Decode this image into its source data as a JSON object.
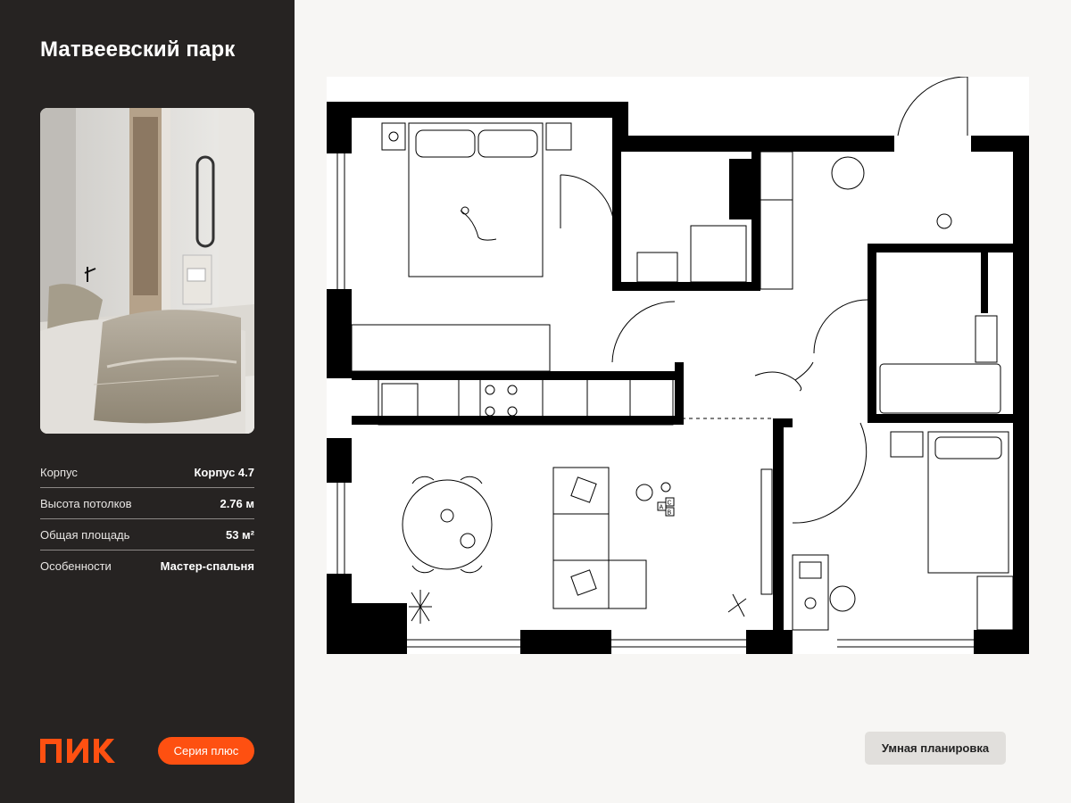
{
  "project": {
    "title": "Матвеевский парк"
  },
  "specs": [
    {
      "label": "Корпус",
      "value": "Корпус 4.7"
    },
    {
      "label": "Высота потолков",
      "value": "2.76 м"
    },
    {
      "label": "Общая площадь",
      "value": "53 м²"
    },
    {
      "label": "Особенности",
      "value": "Мастер-спальня"
    }
  ],
  "brand": {
    "logo_text": "ПИК",
    "accent_color": "#fe5011"
  },
  "series_button": {
    "label": "Серия плюс"
  },
  "badge": {
    "label": "Умная планировка"
  },
  "floorplan": {
    "toy_blocks": [
      "A",
      "C",
      "B"
    ],
    "icons": [
      "bed-icon",
      "sofa-icon",
      "dining-table-icon",
      "toilet-icon",
      "bathtub-icon",
      "shower-icon",
      "sink-icon",
      "stove-icon",
      "washer-icon",
      "plant-icon",
      "cat-icon",
      "dog-icon",
      "desk-icon",
      "chair-icon",
      "toy-plane-icon"
    ]
  }
}
